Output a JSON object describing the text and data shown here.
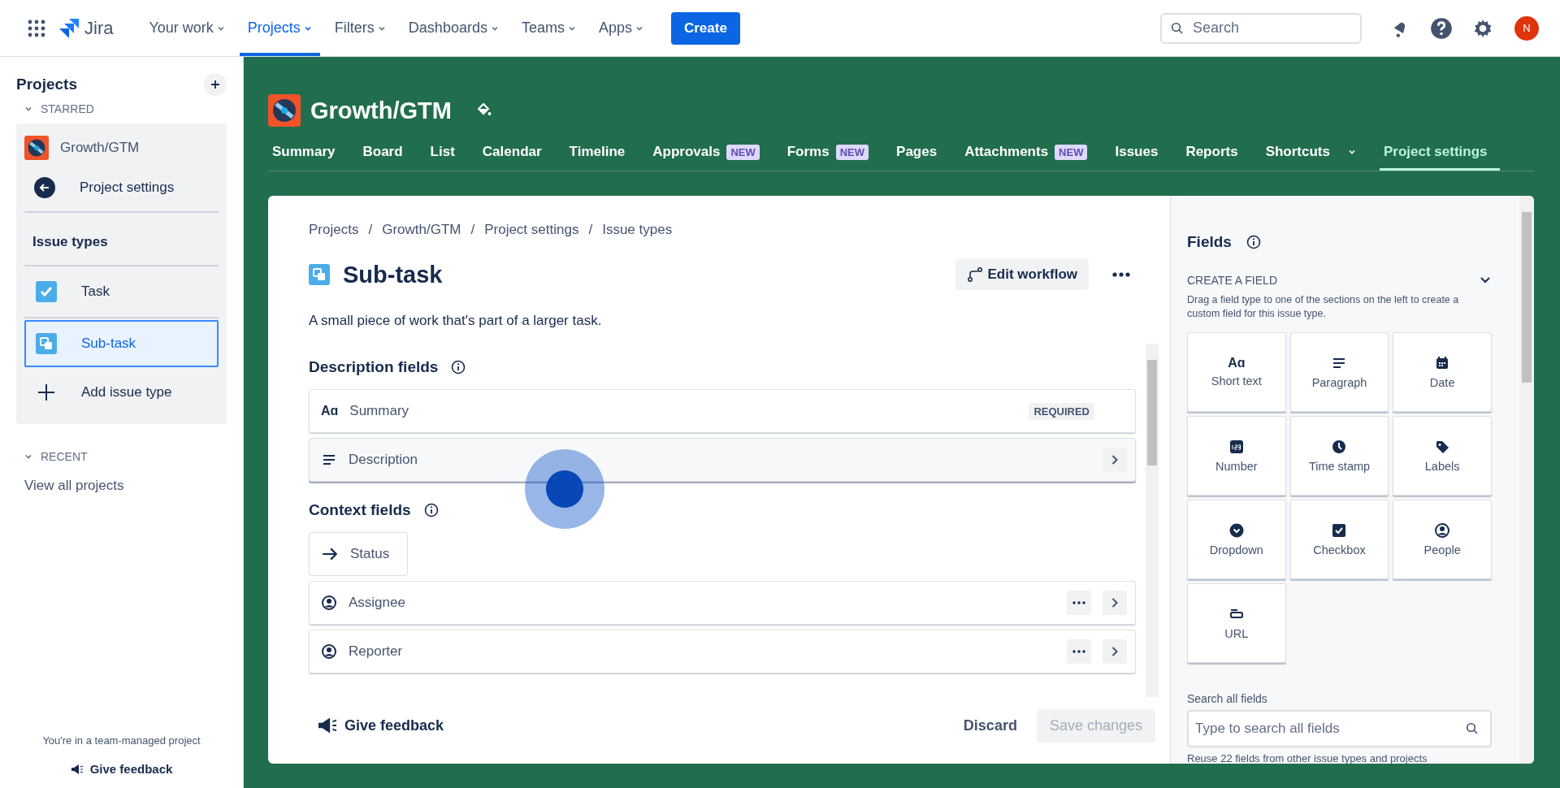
{
  "top_nav": {
    "product": "Jira",
    "items": [
      {
        "label": "Your work",
        "selected": false
      },
      {
        "label": "Projects",
        "selected": true
      },
      {
        "label": "Filters",
        "selected": false
      },
      {
        "label": "Dashboards",
        "selected": false
      },
      {
        "label": "Teams",
        "selected": false
      },
      {
        "label": "Apps",
        "selected": false
      }
    ],
    "create": "Create",
    "search_placeholder": "Search",
    "avatar": "N"
  },
  "sidebar": {
    "title": "Projects",
    "starred_label": "STARRED",
    "project": "Growth/GTM",
    "back": "Project settings",
    "section": "Issue types",
    "items": [
      {
        "label": "Task",
        "kind": "task",
        "selected": false
      },
      {
        "label": "Sub-task",
        "kind": "subtask",
        "selected": true
      },
      {
        "label": "Add issue type",
        "kind": "add",
        "selected": false
      }
    ],
    "recent_label": "RECENT",
    "view_all": "View all projects",
    "footer_note": "You're in a team-managed project",
    "footer_feedback": "Give feedback"
  },
  "project": {
    "name": "Growth/GTM",
    "tabs": [
      {
        "label": "Summary",
        "menu": false,
        "selected": false
      },
      {
        "label": "Board",
        "menu": false,
        "selected": false
      },
      {
        "label": "List",
        "menu": false,
        "selected": false
      },
      {
        "label": "Calendar",
        "menu": false,
        "selected": false
      },
      {
        "label": "Timeline",
        "menu": false,
        "selected": false
      },
      {
        "label": "Approvals",
        "badge": "NEW",
        "menu": false,
        "selected": false
      },
      {
        "label": "Forms",
        "badge": "NEW",
        "menu": false,
        "selected": false
      },
      {
        "label": "Pages",
        "menu": false,
        "selected": false
      },
      {
        "label": "Attachments",
        "badge": "NEW",
        "menu": false,
        "selected": false
      },
      {
        "label": "Issues",
        "menu": false,
        "selected": false
      },
      {
        "label": "Reports",
        "menu": false,
        "selected": false
      },
      {
        "label": "Shortcuts",
        "menu": true,
        "selected": false
      },
      {
        "label": "Project settings",
        "menu": false,
        "selected": true
      }
    ]
  },
  "breadcrumbs": [
    "Projects",
    "Growth/GTM",
    "Project settings",
    "Issue types"
  ],
  "breadcrumb_separator": "/",
  "issue_type": {
    "name": "Sub-task",
    "description": "A small piece of work that's part of a larger task.",
    "edit_workflow": "Edit workflow"
  },
  "sections": [
    {
      "title": "Description fields",
      "fields": [
        {
          "label": "Summary",
          "kind": "text",
          "glyph": "Aɑ",
          "badge": "REQUIRED",
          "more": false,
          "chevron": false,
          "highlighted": false
        },
        {
          "label": "Description",
          "kind": "paragraph",
          "more": false,
          "chevron": true,
          "highlighted": true
        }
      ]
    },
    {
      "title": "Context fields",
      "fields": [
        {
          "label": "Status",
          "kind": "status",
          "more": false,
          "chevron": false,
          "highlighted": false
        },
        {
          "label": "Assignee",
          "kind": "person",
          "more": true,
          "chevron": true,
          "highlighted": false
        },
        {
          "label": "Reporter",
          "kind": "person",
          "more": true,
          "chevron": true,
          "highlighted": false
        }
      ]
    }
  ],
  "footer": {
    "give_feedback": "Give feedback",
    "discard": "Discard",
    "save": "Save changes",
    "save_disabled": true
  },
  "panel": {
    "title": "Fields",
    "create_label": "CREATE A FIELD",
    "expanded": true,
    "description": "Drag a field type to one of the sections on the left to create a custom field for this issue type.",
    "tiles": [
      {
        "label": "Short text",
        "kind": "text",
        "glyph": "Aɑ"
      },
      {
        "label": "Paragraph",
        "kind": "paragraph"
      },
      {
        "label": "Date",
        "kind": "date"
      },
      {
        "label": "Number",
        "kind": "number"
      },
      {
        "label": "Time stamp",
        "kind": "time"
      },
      {
        "label": "Labels",
        "kind": "label"
      },
      {
        "label": "Dropdown",
        "kind": "dropdown"
      },
      {
        "label": "Checkbox",
        "kind": "checkbox"
      },
      {
        "label": "People",
        "kind": "person"
      },
      {
        "label": "URL",
        "kind": "url"
      }
    ],
    "search_label": "Search all fields",
    "search_placeholder": "Type to search all fields",
    "reuse_note": "Reuse 22 fields from other issue types and projects"
  }
}
